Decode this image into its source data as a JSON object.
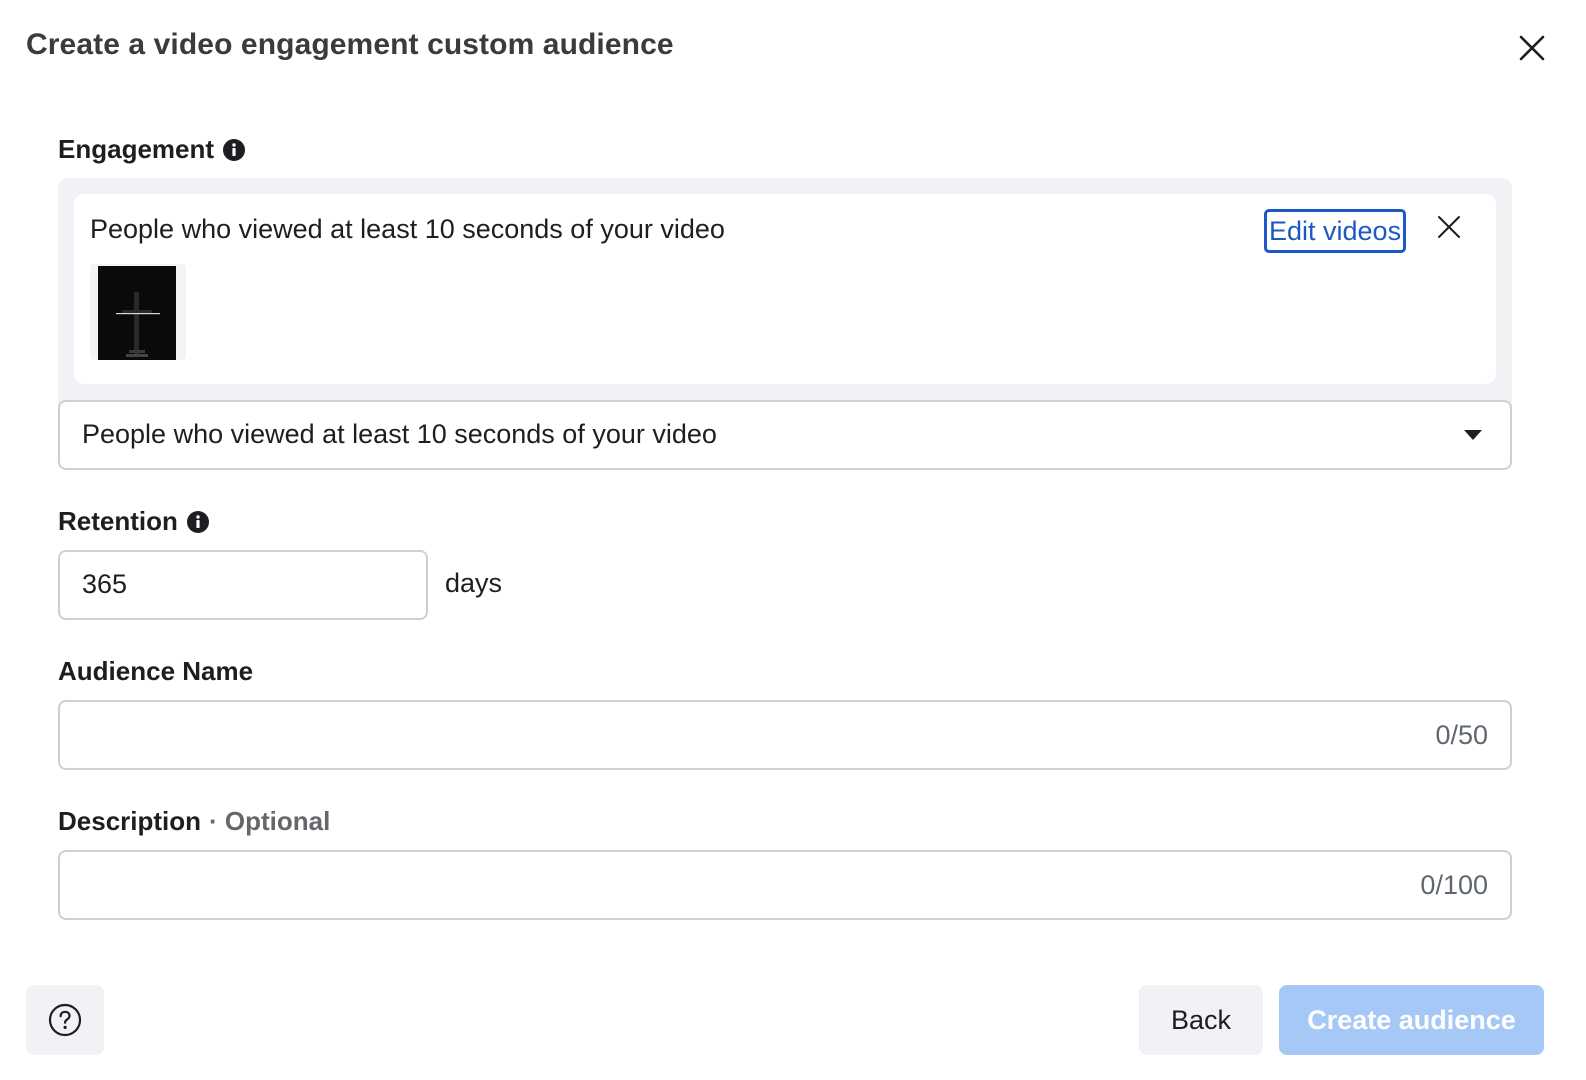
{
  "dialog": {
    "title": "Create a video engagement custom audience"
  },
  "engagement": {
    "label": "Engagement",
    "card_text": "People who viewed at least 10 seconds of your video",
    "edit_videos_label": "Edit videos",
    "select_value": "People who viewed at least 10 seconds of your video"
  },
  "retention": {
    "label": "Retention",
    "value": "365",
    "unit": "days"
  },
  "audience_name": {
    "label": "Audience Name",
    "counter": "0/50"
  },
  "description": {
    "label": "Description",
    "optional": "· Optional",
    "counter": "0/100"
  },
  "footer": {
    "back_label": "Back",
    "create_label": "Create audience"
  },
  "colors": {
    "link": "#1b59c4",
    "primary_disabled": "#a5c8f7",
    "panel_bg": "#f0f2f5",
    "border": "#ccd0d5"
  }
}
